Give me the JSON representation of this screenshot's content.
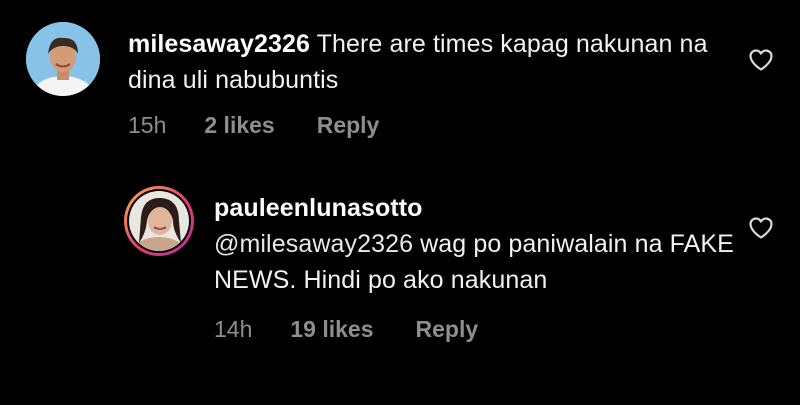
{
  "comments": [
    {
      "username": "milesaway2326",
      "text": "There are times kapag nakunan na dina uli nabubuntis",
      "time": "15h",
      "likes": "2 likes",
      "reply_label": "Reply",
      "like_icon": "heart-outline-icon"
    },
    {
      "username": "pauleenlunasotto",
      "mention": "@milesaway2326",
      "text": " wag po paniwalain na FAKE NEWS. Hindi po ako nakunan",
      "time": "14h",
      "likes": "19 likes",
      "reply_label": "Reply",
      "like_icon": "heart-outline-icon"
    }
  ],
  "colors": {
    "background": "#000000",
    "text": "#f2f2f2",
    "meta": "#8e8e8e",
    "story_ring_start": "#f9b24a",
    "story_ring_end": "#b02fa6"
  }
}
